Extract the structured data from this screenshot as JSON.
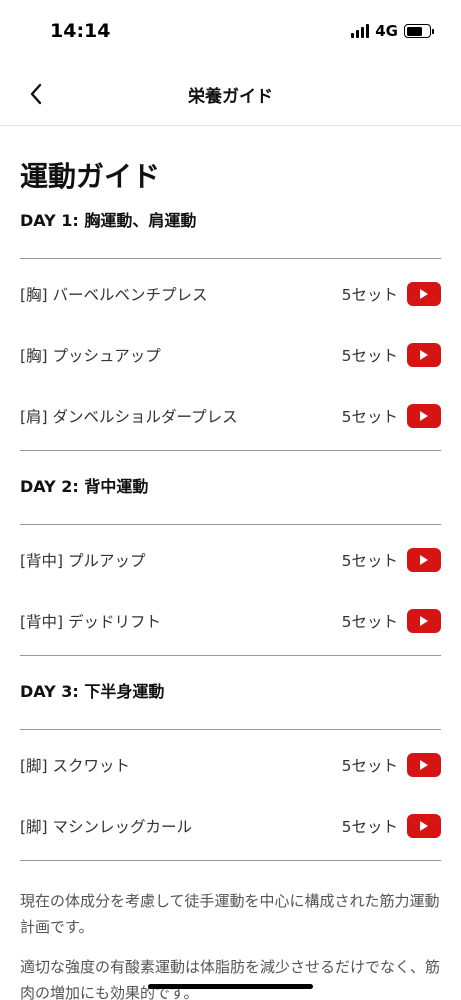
{
  "status_bar": {
    "time": "14:14",
    "network": "4G"
  },
  "nav": {
    "title": "栄養ガイド"
  },
  "page_title": "運動ガイド",
  "days": [
    {
      "title": "DAY 1: 胸運動、肩運動",
      "exercises": [
        {
          "name": "[胸] バーベルベンチプレス",
          "sets": "5セット"
        },
        {
          "name": "[胸] プッシュアップ",
          "sets": "5セット"
        },
        {
          "name": "[肩] ダンベルショルダープレス",
          "sets": "5セット"
        }
      ]
    },
    {
      "title": "DAY 2: 背中運動",
      "exercises": [
        {
          "name": "[背中] プルアップ",
          "sets": "5セット"
        },
        {
          "name": "[背中] デッドリフト",
          "sets": "5セット"
        }
      ]
    },
    {
      "title": "DAY 3: 下半身運動",
      "exercises": [
        {
          "name": "[脚] スクワット",
          "sets": "5セット"
        },
        {
          "name": "[脚] マシンレッグカール",
          "sets": "5セット"
        }
      ]
    }
  ],
  "notes": [
    "現在の体成分を考慮して徒手運動を中心に構成された筋力運動計画です。",
    "適切な強度の有酸素運動は体脂肪を減少させるだけでなく、筋肉の増加にも効果的です。"
  ],
  "colors": {
    "youtube_red": "#d71414",
    "divider": "#999999"
  },
  "icons": {
    "back": "chevron-left-icon",
    "video": "youtube-play-icon"
  }
}
